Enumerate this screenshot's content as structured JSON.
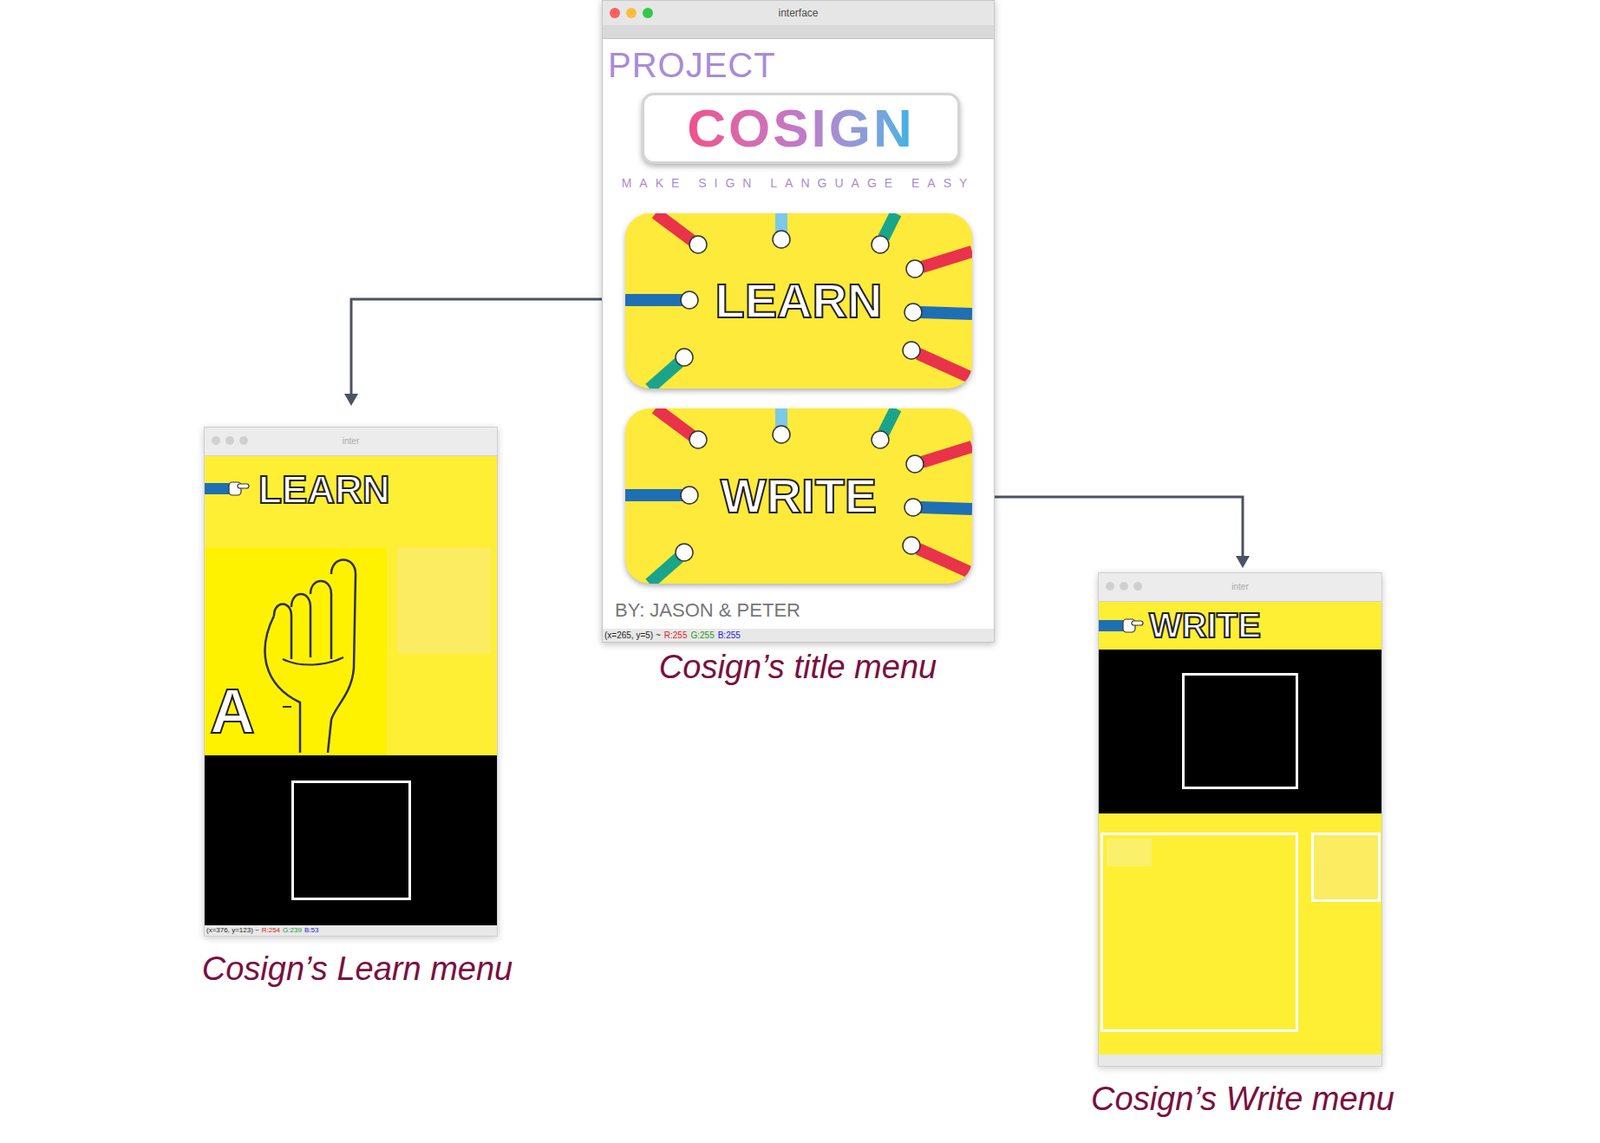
{
  "figure": {
    "captions": [
      "Cosign’s title menu",
      "Cosign’s Learn menu",
      "Cosign’s Write menu"
    ]
  },
  "title_window": {
    "title": "interface",
    "heading": "PROJECT",
    "logo": "COSIGN",
    "tagline": "MAKE SIGN LANGUAGE EASY",
    "buttons": [
      {
        "label": "LEARN"
      },
      {
        "label": "WRITE"
      }
    ],
    "credits": "BY: JASON & PETER",
    "status_bar": {
      "position": "(x=265, y=5) ~",
      "r": "R:255",
      "g": "G:255",
      "b": "B:255"
    }
  },
  "learn_window": {
    "title": "inter",
    "header": "LEARN",
    "letter": "A",
    "status_bar": {
      "position": "(x=376, y=123) ~",
      "r": "R:254",
      "g": "G:239",
      "b": "B:53"
    }
  },
  "write_window": {
    "title": "inter",
    "header": "WRITE"
  }
}
